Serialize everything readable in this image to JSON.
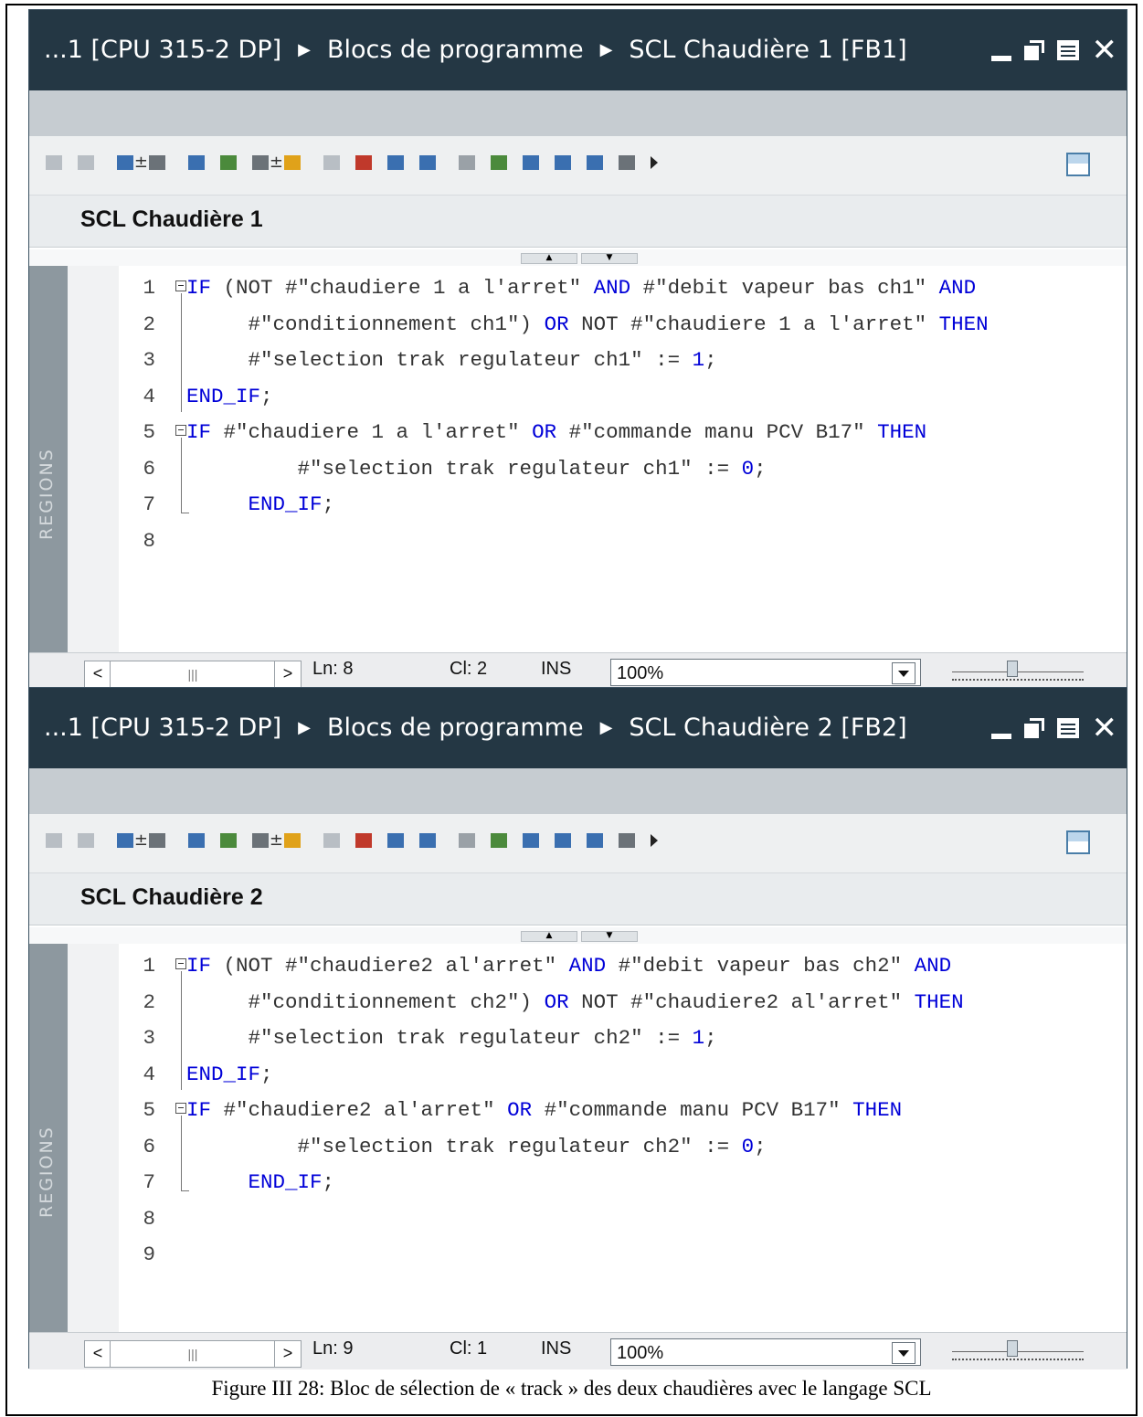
{
  "editors": [
    {
      "breadcrumb": [
        "...1 [CPU 315-2 DP]",
        "Blocs de programme",
        "SCL Chaudière 1 [FB1]"
      ],
      "block_title": "SCL Chaudière 1",
      "regions_label": "REGIONS",
      "lines": [
        {
          "n": "1",
          "tokens": [
            {
              "t": "IF",
              "c": "kw"
            },
            {
              "t": " (NOT #\"chaudiere 1 a l'arret\" "
            },
            {
              "t": "AND",
              "c": "kw"
            },
            {
              "t": " #\"debit vapeur bas ch1\" "
            },
            {
              "t": "AND",
              "c": "kw"
            }
          ]
        },
        {
          "n": "2",
          "tokens": [
            {
              "t": "     #\"conditionnement ch1\") "
            },
            {
              "t": "OR",
              "c": "kw"
            },
            {
              "t": " NOT #\"chaudiere 1 a l'arret\" "
            },
            {
              "t": "THEN",
              "c": "kw"
            }
          ]
        },
        {
          "n": "3",
          "tokens": [
            {
              "t": "     #\"selection trak regulateur ch1\" := "
            },
            {
              "t": "1",
              "c": "num"
            },
            {
              "t": ";"
            }
          ]
        },
        {
          "n": "4",
          "tokens": [
            {
              "t": "END_IF",
              "c": "kw"
            },
            {
              "t": ";"
            }
          ]
        },
        {
          "n": "5",
          "tokens": [
            {
              "t": "IF",
              "c": "kw"
            },
            {
              "t": " #\"chaudiere 1 a l'arret\" "
            },
            {
              "t": "OR",
              "c": "kw"
            },
            {
              "t": " #\"commande manu PCV B17\" "
            },
            {
              "t": "THEN",
              "c": "kw"
            }
          ]
        },
        {
          "n": "6",
          "tokens": [
            {
              "t": "         #\"selection trak regulateur ch1\" := "
            },
            {
              "t": "0",
              "c": "num"
            },
            {
              "t": ";"
            }
          ]
        },
        {
          "n": "7",
          "tokens": [
            {
              "t": "     "
            },
            {
              "t": "END_IF",
              "c": "kw"
            },
            {
              "t": ";"
            }
          ]
        },
        {
          "n": "8",
          "tokens": []
        }
      ],
      "status": {
        "ln": "Ln: 8",
        "cl": "Cl: 2",
        "mode": "INS",
        "zoom": "100%"
      }
    },
    {
      "breadcrumb": [
        "...1 [CPU 315-2 DP]",
        "Blocs de programme",
        "SCL Chaudière 2 [FB2]"
      ],
      "block_title": "SCL Chaudière 2",
      "regions_label": "REGIONS",
      "lines": [
        {
          "n": "1",
          "tokens": [
            {
              "t": "IF",
              "c": "kw"
            },
            {
              "t": " (NOT #\"chaudiere2 al'arret\" "
            },
            {
              "t": "AND",
              "c": "kw"
            },
            {
              "t": " #\"debit vapeur bas ch2\" "
            },
            {
              "t": "AND",
              "c": "kw"
            }
          ]
        },
        {
          "n": "2",
          "tokens": [
            {
              "t": "     #\"conditionnement ch2\") "
            },
            {
              "t": "OR",
              "c": "kw"
            },
            {
              "t": " NOT #\"chaudiere2 al'arret\" "
            },
            {
              "t": "THEN",
              "c": "kw"
            }
          ]
        },
        {
          "n": "3",
          "tokens": [
            {
              "t": "     #\"selection trak regulateur ch2\" := "
            },
            {
              "t": "1",
              "c": "num"
            },
            {
              "t": ";"
            }
          ]
        },
        {
          "n": "4",
          "tokens": [
            {
              "t": "END_IF",
              "c": "kw"
            },
            {
              "t": ";"
            }
          ]
        },
        {
          "n": "5",
          "tokens": [
            {
              "t": "IF",
              "c": "kw"
            },
            {
              "t": " #\"chaudiere2 al'arret\" "
            },
            {
              "t": "OR",
              "c": "kw"
            },
            {
              "t": " #\"commande manu PCV B17\" "
            },
            {
              "t": "THEN",
              "c": "kw"
            }
          ]
        },
        {
          "n": "6",
          "tokens": [
            {
              "t": "         #\"selection trak regulateur ch2\" := "
            },
            {
              "t": "0",
              "c": "num"
            },
            {
              "t": ";"
            }
          ]
        },
        {
          "n": "7",
          "tokens": [
            {
              "t": "     "
            },
            {
              "t": "END_IF",
              "c": "kw"
            },
            {
              "t": ";"
            }
          ]
        },
        {
          "n": "8",
          "tokens": []
        },
        {
          "n": "9",
          "tokens": []
        }
      ],
      "status": {
        "ln": "Ln: 9",
        "cl": "Cl: 1",
        "mode": "INS",
        "zoom": "100%"
      }
    }
  ],
  "caption": "Figure III 28: Bloc de sélection de « track » des deux chaudières avec le langage SCL",
  "colors": {
    "titlebar": "#243744",
    "keyword": "#0000d8",
    "regions": "#8d989f"
  }
}
